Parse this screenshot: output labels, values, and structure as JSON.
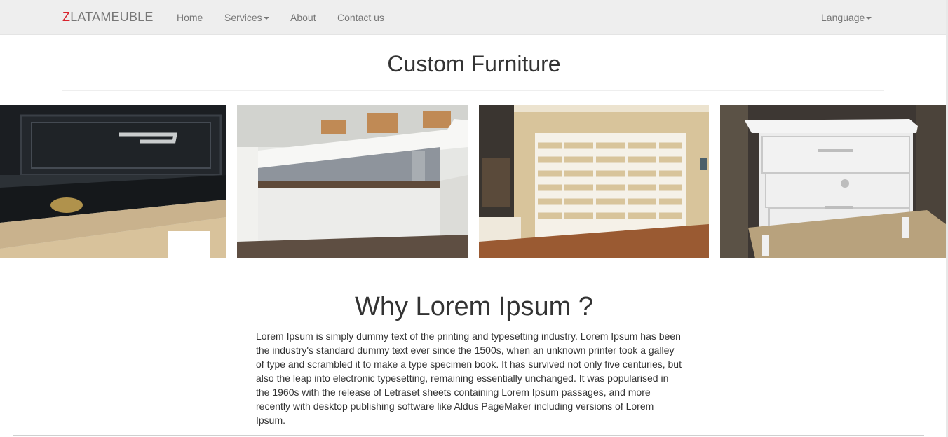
{
  "navbar": {
    "brand_first": "Z",
    "brand_rest": "LATAMEUBLE",
    "items": [
      {
        "label": "Home"
      },
      {
        "label": "Services"
      },
      {
        "label": "About"
      },
      {
        "label": "Contact us"
      }
    ],
    "language_label": "Language"
  },
  "header": {
    "title": "Custom Furniture"
  },
  "gallery": [
    {
      "icon": "dark-drawer-photo"
    },
    {
      "icon": "white-counter-photo"
    },
    {
      "icon": "bookshelf-photo"
    },
    {
      "icon": "white-dresser-photo"
    }
  ],
  "why": {
    "title": "Why Lorem Ipsum ?",
    "lines": [
      "Lorem Ipsum is simply dummy text of the printing and typesetting industry. Lorem Ipsum has been",
      "the industry's standard dummy text ever since the 1500s, when an unknown printer took a galley",
      "of type and scrambled it to make a type specimen book. It has survived not only five centuries, but",
      "also the leap into electronic typesetting, remaining essentially unchanged. It was popularised in",
      "the 1960s with the release of Letraset sheets containing Lorem Ipsum passages, and more",
      "recently with desktop publishing software like Aldus PageMaker including versions of Lorem",
      "Ipsum."
    ]
  },
  "colors": {
    "brand_accent": "#d9232d",
    "navbar_bg": "#eeeeee",
    "nav_text": "#777777",
    "body_text": "#333333"
  }
}
